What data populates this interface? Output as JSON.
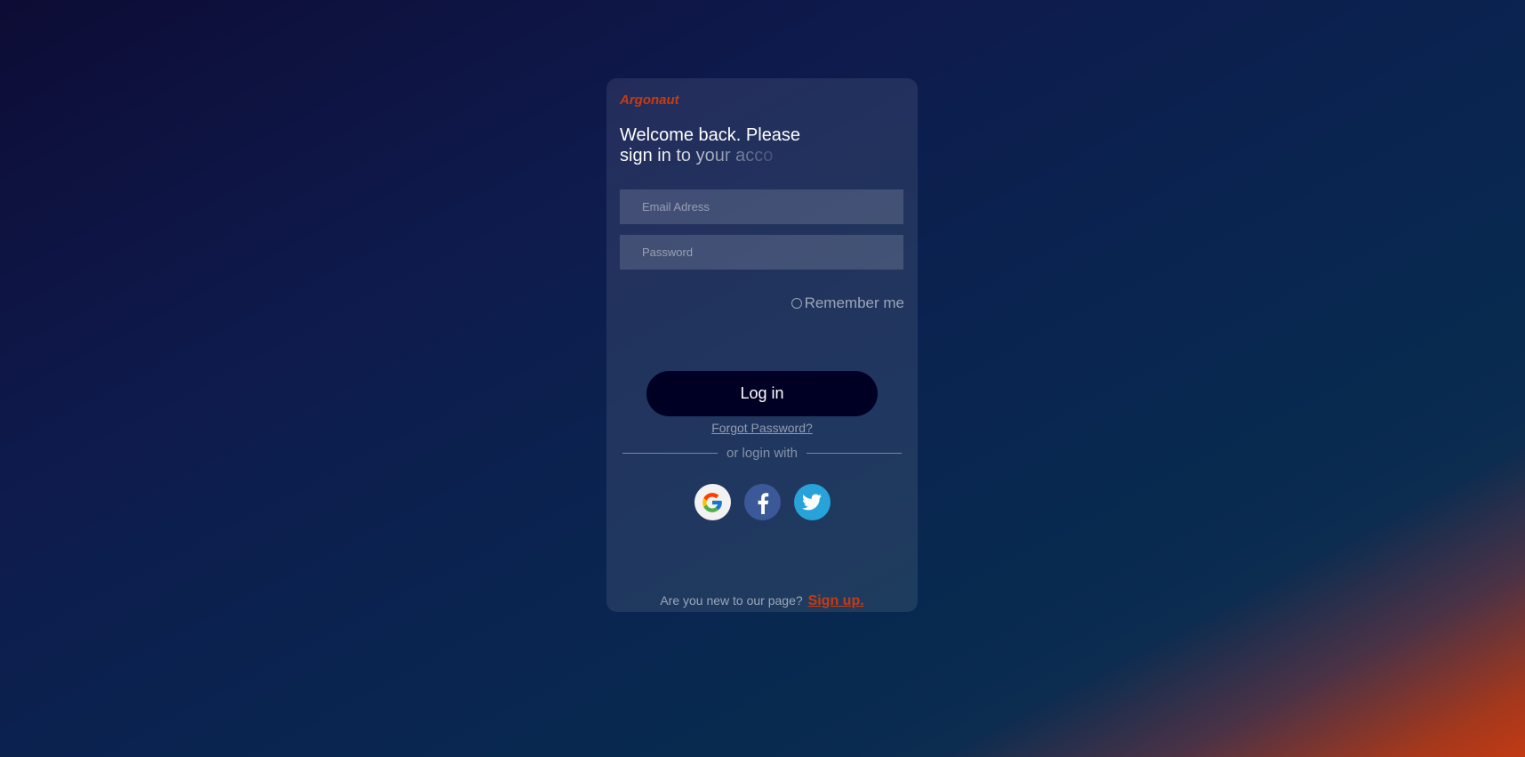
{
  "brand": {
    "name": "Argonaut"
  },
  "heading": {
    "line1": "Welcome back. Please",
    "line2": "sign in to your acco"
  },
  "form": {
    "email_placeholder": "Email Adress",
    "password_placeholder": "Password",
    "remember_label": "Remember me",
    "login_label": "Log in",
    "forgot_label": "Forgot Password?"
  },
  "divider": {
    "label": "or login with"
  },
  "social": {
    "providers": [
      {
        "name": "Google",
        "icon": "google-icon",
        "color": "#f2f2f2"
      },
      {
        "name": "Facebook",
        "icon": "facebook-icon",
        "color": "#3b5998"
      },
      {
        "name": "Twitter",
        "icon": "twitter-icon",
        "color": "#27a3d9"
      }
    ]
  },
  "signup": {
    "prompt": "Are you new to our page?",
    "link_label": "Sign up."
  },
  "colors": {
    "accent": "#c93a10",
    "button": "#000024"
  }
}
